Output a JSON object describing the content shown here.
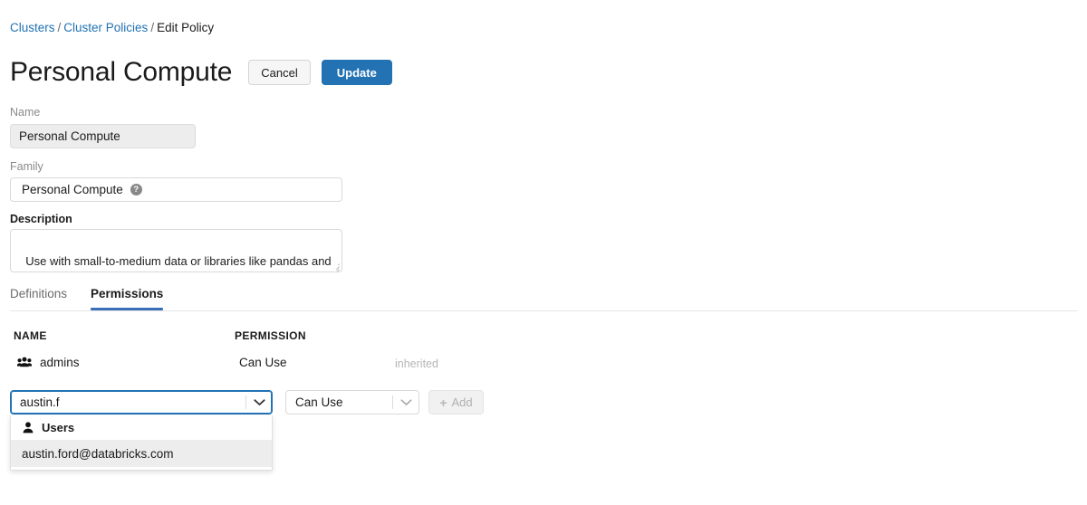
{
  "breadcrumb": {
    "items": [
      {
        "label": "Clusters",
        "link": true
      },
      {
        "label": "Cluster Policies",
        "link": true
      },
      {
        "label": "Edit Policy",
        "link": false
      }
    ],
    "separator": "/"
  },
  "header": {
    "title": "Personal Compute",
    "cancel_label": "Cancel",
    "update_label": "Update"
  },
  "form": {
    "name": {
      "label": "Name",
      "value": "Personal Compute",
      "disabled": true
    },
    "family": {
      "label": "Family",
      "value": "Personal Compute",
      "help_icon": "?"
    },
    "description": {
      "label": "Description",
      "value": "Use with small-to-medium data or libraries like pandas and scikit-learn. Spark runs in local mode."
    }
  },
  "tabs": [
    {
      "label": "Definitions",
      "active": false
    },
    {
      "label": "Permissions",
      "active": true
    }
  ],
  "permissions_table": {
    "columns": [
      "NAME",
      "PERMISSION"
    ],
    "rows": [
      {
        "icon": "users-group-icon",
        "name": "admins",
        "permission": "Can Use",
        "note": "inherited"
      }
    ]
  },
  "add_permission": {
    "principal_select": {
      "value": "austin.f",
      "placeholder": "austin.f",
      "focused": true
    },
    "permission_select": {
      "value": "Can Use",
      "options": [
        "Can Use"
      ]
    },
    "add_button": {
      "label": "Add",
      "plus": "+",
      "disabled": true
    }
  },
  "dropdown": {
    "groups": [
      {
        "icon": "user-icon",
        "label": "Users",
        "options": [
          {
            "label": "austin.ford@databricks.com",
            "highlighted": true
          }
        ]
      }
    ]
  },
  "colors": {
    "link": "#2272b4",
    "primary_button": "#2272b4",
    "tab_underline": "#3a6fb8",
    "focus_border": "#2272b4",
    "muted_text": "#8a8a8a",
    "inherited_text": "#b5b5b5"
  }
}
